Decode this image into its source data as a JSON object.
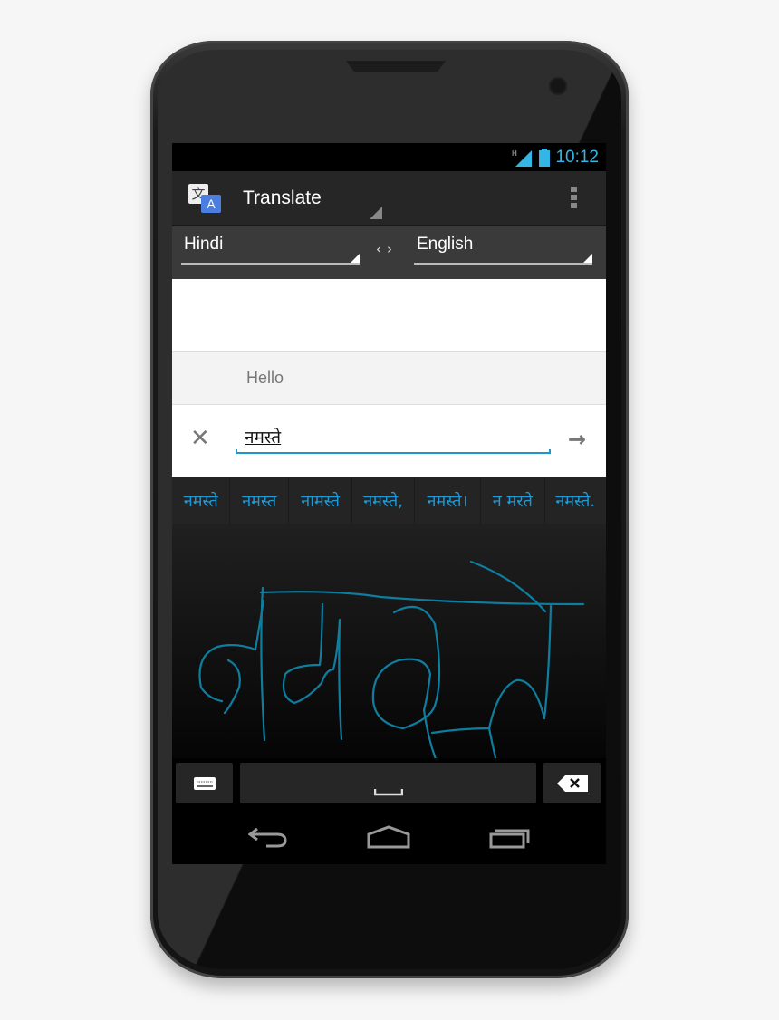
{
  "status_bar": {
    "network_type": "H",
    "time": "10:12",
    "accent_color": "#33b5e5"
  },
  "action_bar": {
    "app_icon": "translate-app-icon",
    "title": "Translate",
    "overflow_icon": "overflow-menu-icon"
  },
  "language_bar": {
    "source_language": "Hindi",
    "target_language": "English",
    "swap_icon": "swap-languages-icon"
  },
  "translation": {
    "result_text": "Hello"
  },
  "input": {
    "value": "नमस्ते",
    "clear_icon": "clear-icon",
    "submit_icon": "arrow-right-icon"
  },
  "suggestions": [
    "नमस्ते",
    "नमस्त",
    "नामस्ते",
    "नमस्ते,",
    "नमस्ते।",
    "न मरते",
    "नमस्ते."
  ],
  "handwriting": {
    "ink_color": "#0e7ea0"
  },
  "keyboard": {
    "keyboard_icon": "keyboard-icon",
    "space_icon": "space-icon",
    "backspace_icon": "backspace-icon"
  },
  "navigation": {
    "back_icon": "back-icon",
    "home_icon": "home-icon",
    "recents_icon": "recent-apps-icon"
  }
}
